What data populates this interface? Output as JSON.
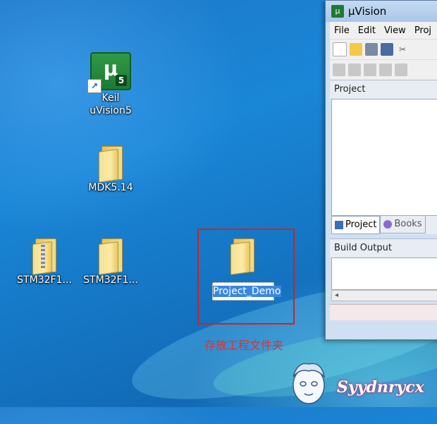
{
  "desktop": {
    "icons": [
      {
        "label": "Keil\nuVision5"
      },
      {
        "label": "MDK5.14"
      },
      {
        "label": "STM32F1..."
      },
      {
        "label": "STM32F1..."
      }
    ],
    "selected_folder": {
      "label": "Project_Demo"
    },
    "annotation": "存放工程文件夹",
    "watermark": "Syydnrycx"
  },
  "uvision": {
    "title": "µVision",
    "menu": [
      "File",
      "Edit",
      "View",
      "Proj"
    ],
    "project_panel_title": "Project",
    "tabs": [
      {
        "label": "Project",
        "icon": "project-tab-icon"
      },
      {
        "label": "Books",
        "icon": "books-tab-icon"
      }
    ],
    "build_output_title": "Build Output"
  },
  "colors": {
    "highlight": "#d42020",
    "selection": "#3a87e0",
    "keil_green": "#1d7a33"
  }
}
